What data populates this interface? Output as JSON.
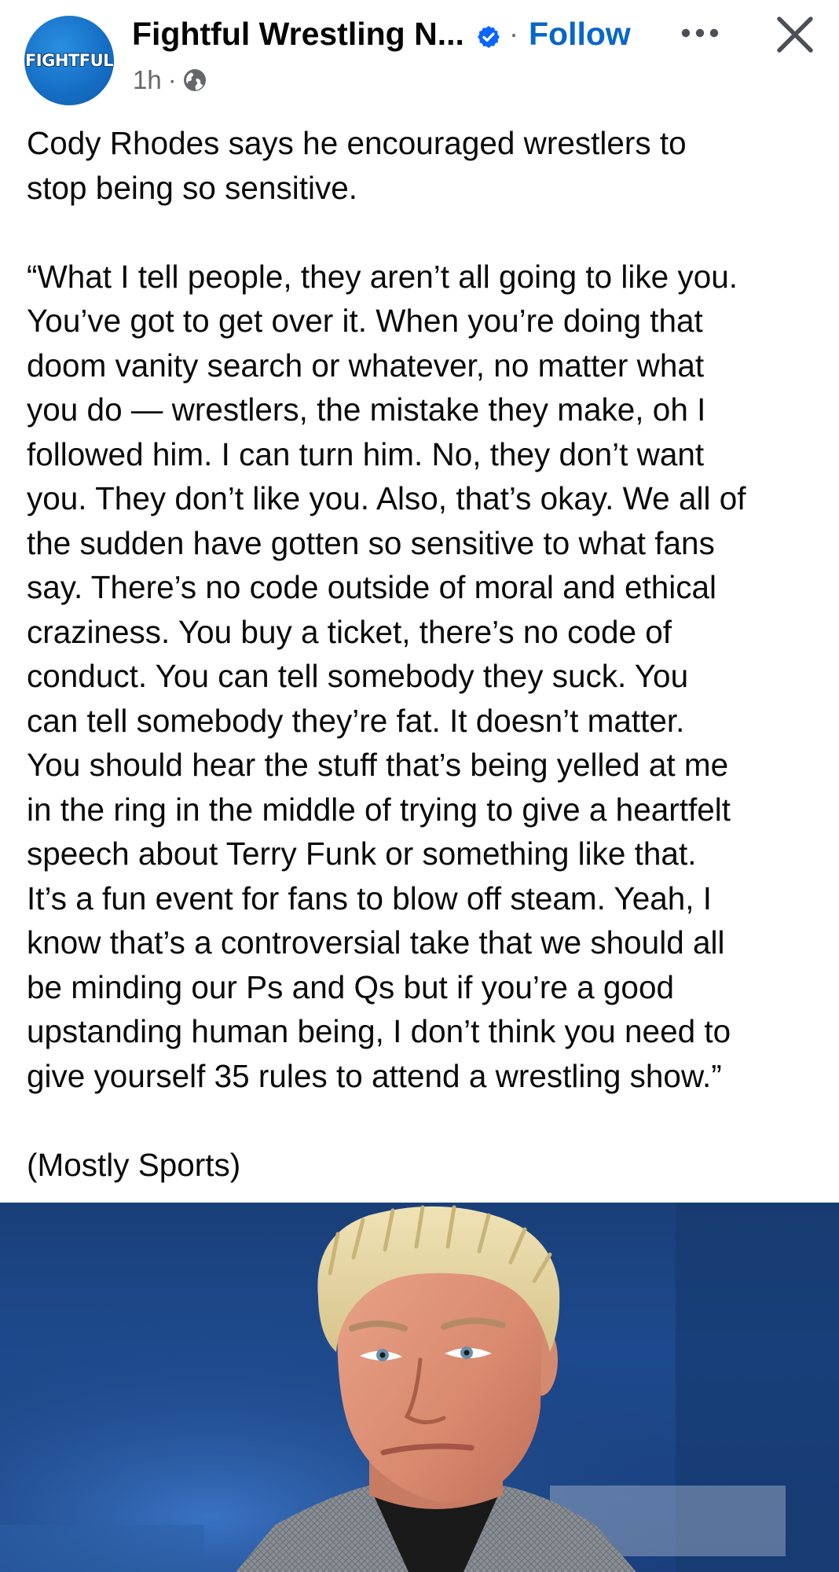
{
  "post": {
    "page_name": "Fightful Wrestling N...",
    "follow_label": "Follow",
    "separator": "·",
    "time": "1h",
    "avatar_text": "FIGHTFUL",
    "icons": {
      "verified": "verified-badge-icon",
      "more": "more-options-icon",
      "close": "close-icon",
      "audience": "globe-icon"
    },
    "colors": {
      "follow": "#0866c8",
      "verified": "#0866ff",
      "avatar": "#1670c6",
      "meta": "#65676b"
    },
    "text_lines": [
      "Cody Rhodes says he encouraged wrestlers to",
      "stop being so sensitive.",
      "",
      "“What I tell people, they aren’t all going to like you.",
      "You’ve got to get over it. When you’re doing that",
      "doom vanity search or whatever, no matter what",
      "you do — wrestlers, the mistake they make, oh I",
      "followed him. I can turn him. No, they don’t want",
      "you. They don’t like you. Also, that’s okay. We all of",
      "the sudden have gotten so sensitive to what fans",
      "say. There’s no code outside of moral and ethical",
      "craziness. You buy a ticket, there’s no code of",
      "conduct. You can tell somebody they suck. You",
      "can tell somebody they’re fat. It doesn’t matter.",
      "You should hear the stuff that’s being yelled at me",
      "in the ring in the middle of trying to give a heartfelt",
      "speech about Terry Funk or something like that.",
      "It’s a fun event for fans to blow off steam. Yeah, I",
      "know that’s a controversial take that we should all",
      "be minding our Ps and Qs but if you’re a good",
      "upstanding human being, I don’t think you need to",
      "give yourself 35 rules to attend a wrestling show.”",
      "",
      "(Mostly Sports)"
    ]
  }
}
